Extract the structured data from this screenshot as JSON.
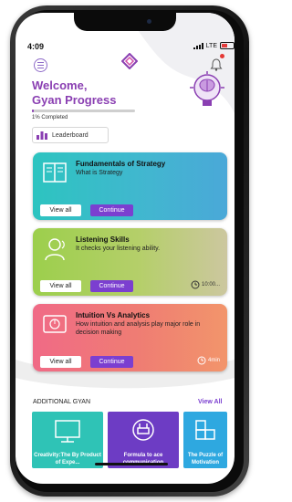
{
  "status_bar": {
    "time": "4:09",
    "network": "LTE"
  },
  "header": {
    "welcome_line1": "Welcome,",
    "welcome_line2": "Gyan Progress",
    "progress_text": "1% Completed",
    "progress_value": 0.01,
    "leaderboard_label": "Leaderboard"
  },
  "courses": [
    {
      "title": "Fundamentals of Strategy",
      "description": "What is Strategy",
      "view_label": "View all",
      "continue_label": "Continue",
      "duration": ""
    },
    {
      "title": "Listening Skills",
      "description": "It checks your listening ability.",
      "view_label": "View all",
      "continue_label": "Continue",
      "duration": "10:00..."
    },
    {
      "title": "Intuition Vs Analytics",
      "description": "How intuition and analysis play major role in decision making",
      "view_label": "View all",
      "continue_label": "Continue",
      "duration": "4min"
    }
  ],
  "additional": {
    "heading": "ADDITIONAL GYAN",
    "view_all": "View All",
    "items": [
      {
        "title": "Creativity:The By Product of Expe..."
      },
      {
        "title": "Formula to ace communication"
      },
      {
        "title": "The Puzzle of Motivation"
      }
    ]
  },
  "colors": {
    "brand_purple": "#8a3fb2",
    "button_purple": "#7b3fd0"
  }
}
